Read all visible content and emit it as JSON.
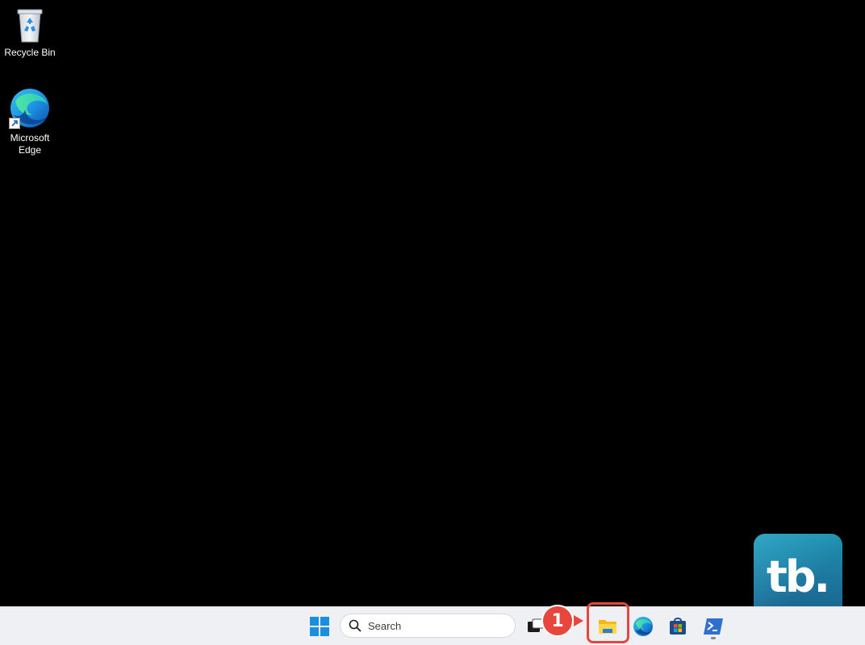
{
  "desktop": {
    "background_color": "#000000",
    "icons": [
      {
        "label": "Recycle Bin",
        "icon": "recycle-bin-icon"
      },
      {
        "label": "Microsoft\nEdge",
        "icon": "edge-icon"
      }
    ]
  },
  "taskbar": {
    "background_color": "#eef0f3",
    "start_icon": "windows-start-icon",
    "search": {
      "placeholder": "Search",
      "icon": "search-icon"
    },
    "apps": [
      {
        "name": "Task View",
        "icon": "task-view-icon"
      },
      {
        "name": "File Explorer",
        "icon": "file-explorer-icon"
      },
      {
        "name": "Microsoft Edge",
        "icon": "edge-icon"
      },
      {
        "name": "Microsoft Store",
        "icon": "store-icon"
      },
      {
        "name": "Terminal",
        "icon": "terminal-icon",
        "running": true
      }
    ]
  },
  "annotation": {
    "step_number": "1",
    "color": "#e8453c"
  },
  "watermark": {
    "text": "tb."
  }
}
